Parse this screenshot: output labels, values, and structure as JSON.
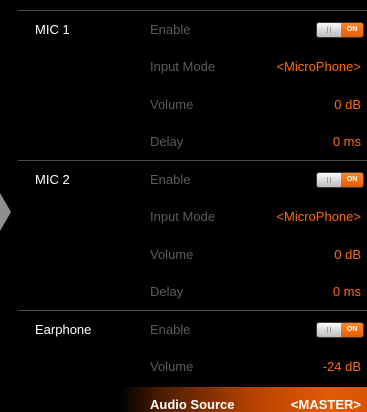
{
  "sections": [
    {
      "label": "MIC 1",
      "enable": {
        "label": "Enable",
        "state": "ON"
      },
      "input_mode": {
        "label": "Input Mode",
        "value": "<MicroPhone>"
      },
      "volume": {
        "label": "Volume",
        "value": "0 dB"
      },
      "delay": {
        "label": "Delay",
        "value": "0 ms"
      }
    },
    {
      "label": "MIC 2",
      "enable": {
        "label": "Enable",
        "state": "ON"
      },
      "input_mode": {
        "label": "Input Mode",
        "value": "<MicroPhone>"
      },
      "volume": {
        "label": "Volume",
        "value": "0 dB"
      },
      "delay": {
        "label": "Delay",
        "value": "0 ms"
      }
    },
    {
      "label": "Earphone",
      "enable": {
        "label": "Enable",
        "state": "ON"
      },
      "volume": {
        "label": "Volume",
        "value": "-24 dB"
      },
      "audio_source": {
        "label": "Audio Source",
        "value": "<MASTER>",
        "selected": true
      }
    }
  ],
  "colors": {
    "accent": "#ff6a10",
    "label_dim": "#5b5b5b",
    "section_label": "#ffffff",
    "background": "#000000",
    "selection_gradient_end": "#e35a06"
  },
  "icons": {
    "side_arrow": "chevron-right-icon"
  }
}
